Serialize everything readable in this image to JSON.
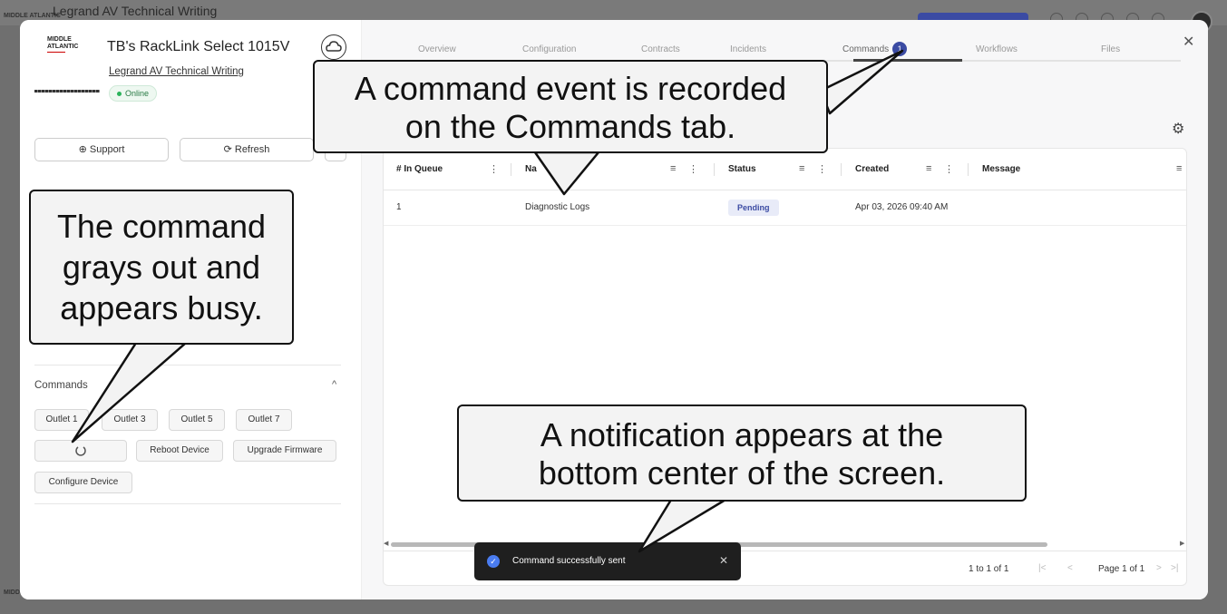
{
  "background": {
    "app_title": "Legrand AV Technical Writing",
    "brand_small": "MIDDLE ATLANTIC"
  },
  "device": {
    "brand_line1": "MIDDLE",
    "brand_line2": "ATLANTIC",
    "title": "TB's RackLink Select 1015V",
    "org": "Legrand AV Technical Writing",
    "status": "Online",
    "support_label": "Support",
    "refresh_label": "Refresh"
  },
  "commands": {
    "header": "Commands",
    "buttons": [
      "Outlet 1",
      "Outlet 3",
      "Outlet 5",
      "Outlet 7"
    ],
    "reboot_label": "Reboot Device",
    "upgrade_label": "Upgrade Firmware",
    "configure_label": "Configure Device"
  },
  "tabs": {
    "items": [
      "Overview",
      "Configuration",
      "Contracts",
      "Incidents",
      "Commands",
      "Workflows",
      "Files"
    ],
    "active": "Commands",
    "commands_badge": "1"
  },
  "table": {
    "columns": [
      "# In Queue",
      "Na",
      "Status",
      "Created",
      "Message"
    ],
    "rows": [
      {
        "queue": "1",
        "name": "Diagnostic Logs",
        "status": "Pending",
        "created": "Apr 03, 2026 09:40 AM",
        "message": ""
      }
    ],
    "pagination_range": "1 to 1 of 1",
    "page_text": "Page 1 of 1"
  },
  "toast": {
    "message": "Command successfully sent"
  },
  "callouts": {
    "tab_line1": "A command event is recorded",
    "tab_line2": "on the Commands tab.",
    "busy_line1": "The command",
    "busy_line2": "grays out and",
    "busy_line3": "appears busy.",
    "notify_line1": "A notification appears at the",
    "notify_line2": "bottom center of the screen."
  },
  "colors": {
    "accent": "#3b4ba3",
    "online": "#2bb35b",
    "pending_bg": "#e8ebf8",
    "toast_bg": "#1f1f1f",
    "callout_bg": "#f3f3f3"
  }
}
